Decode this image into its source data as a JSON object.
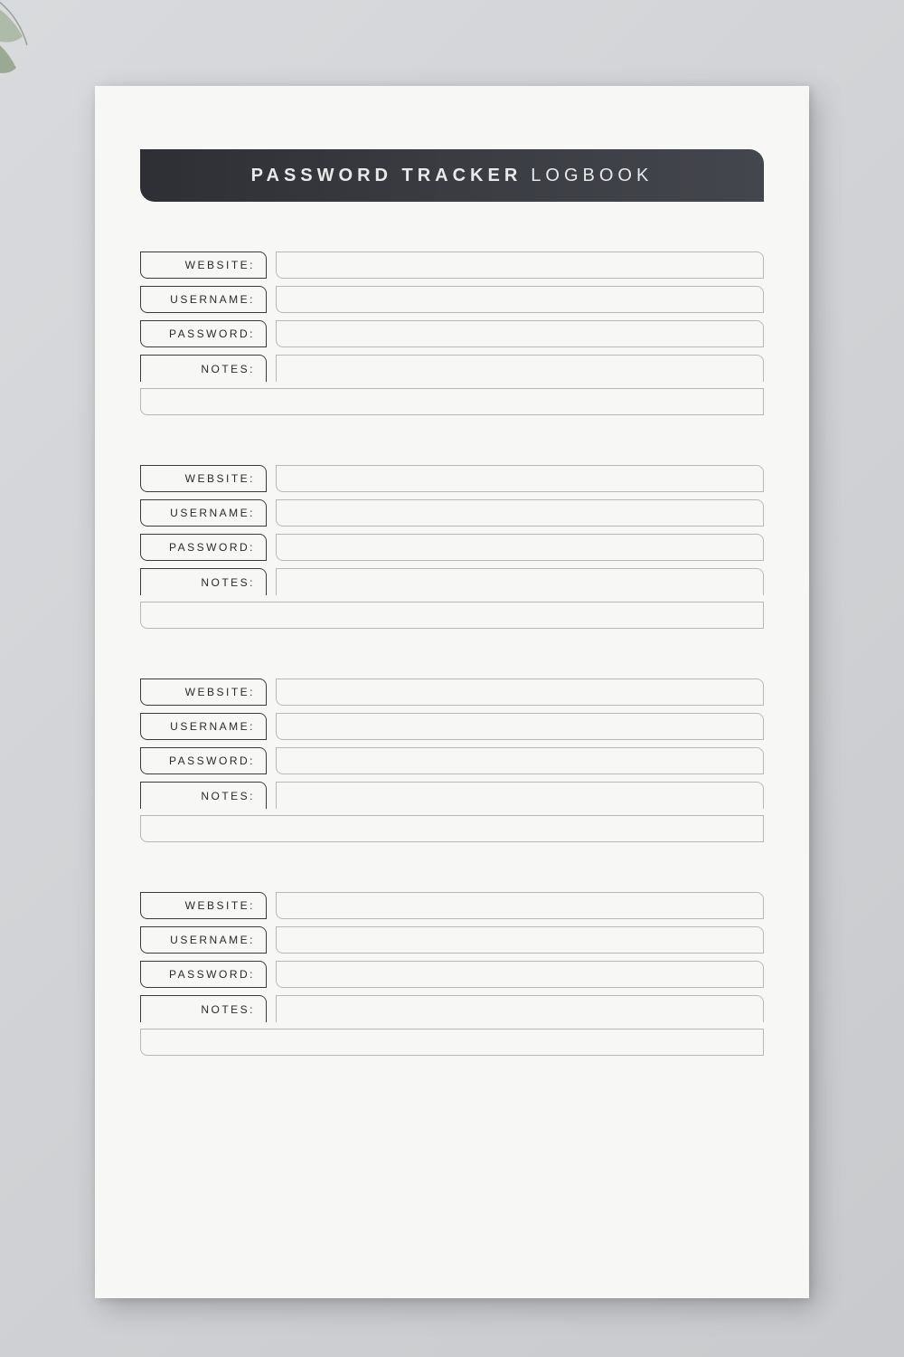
{
  "title": {
    "bold": "PASSWORD TRACKER",
    "light": "LOGBOOK"
  },
  "labels": {
    "website": "WEBSITE:",
    "username": "USERNAME:",
    "password": "PASSWORD:",
    "notes": "NOTES:"
  },
  "entries": [
    {
      "website": "",
      "username": "",
      "password": "",
      "notes": ""
    },
    {
      "website": "",
      "username": "",
      "password": "",
      "notes": ""
    },
    {
      "website": "",
      "username": "",
      "password": "",
      "notes": ""
    },
    {
      "website": "",
      "username": "",
      "password": "",
      "notes": ""
    }
  ]
}
